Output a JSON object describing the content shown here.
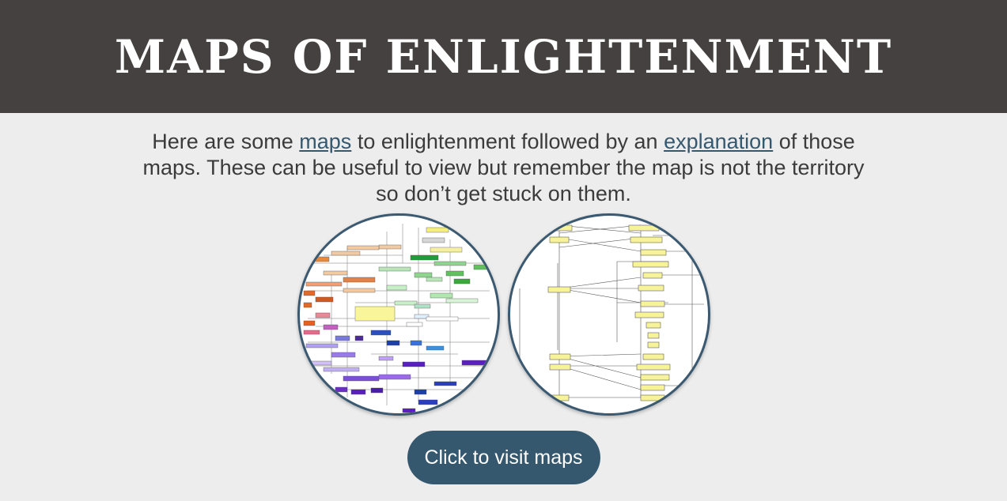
{
  "header": {
    "title": "MAPS OF ENLIGHTENMENT"
  },
  "intro": {
    "text_before_maps": "Here are some ",
    "maps_link": "maps",
    "text_middle": " to enlightenment followed by an ",
    "explanation_link": "explanation",
    "text_after": " of those maps. These can be useful to view but remember the map is not the territory so don’t get stuck on them."
  },
  "cta": {
    "label": "Click to visit maps"
  },
  "colors": {
    "header_bg": "#454141",
    "page_bg": "#ededed",
    "accent": "#35586f",
    "circle_border": "#3b5a72"
  },
  "images": [
    {
      "name": "colorful-map-thumbnail"
    },
    {
      "name": "flowchart-map-thumbnail"
    }
  ]
}
